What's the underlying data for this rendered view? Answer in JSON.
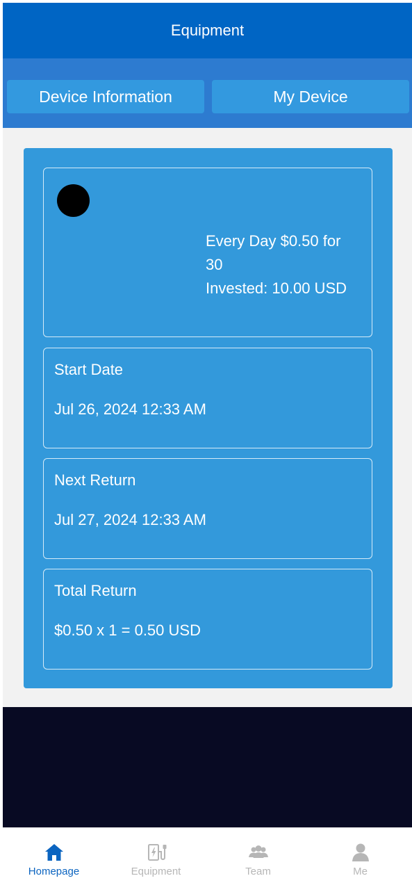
{
  "header": {
    "title": "Equipment"
  },
  "tabs": [
    {
      "label": "Device Information"
    },
    {
      "label": "My Device"
    }
  ],
  "product": {
    "plan_line1": "Every Day $0.50 for",
    "plan_line2": "30",
    "invested": "Invested: 10.00 USD"
  },
  "details": [
    {
      "label": "Start Date",
      "value": "Jul 26, 2024 12:33 AM"
    },
    {
      "label": "Next Return",
      "value": "Jul 27, 2024 12:33 AM"
    },
    {
      "label": "Total Return",
      "value": "$0.50 x 1 = 0.50 USD"
    }
  ],
  "bottom_nav": [
    {
      "label": "Homepage",
      "icon": "home-icon",
      "active": true
    },
    {
      "label": "Equipment",
      "icon": "equipment-icon",
      "active": false
    },
    {
      "label": "Team",
      "icon": "team-icon",
      "active": false
    },
    {
      "label": "Me",
      "icon": "user-icon",
      "active": false
    }
  ],
  "colors": {
    "header": "#0065c4",
    "tabbar": "#2d7bd0",
    "tab": "#3399df",
    "card": "#3399db",
    "dark_panel": "#080a23",
    "nav_active": "#0b64c0",
    "nav_inactive": "#b6b6b6"
  }
}
